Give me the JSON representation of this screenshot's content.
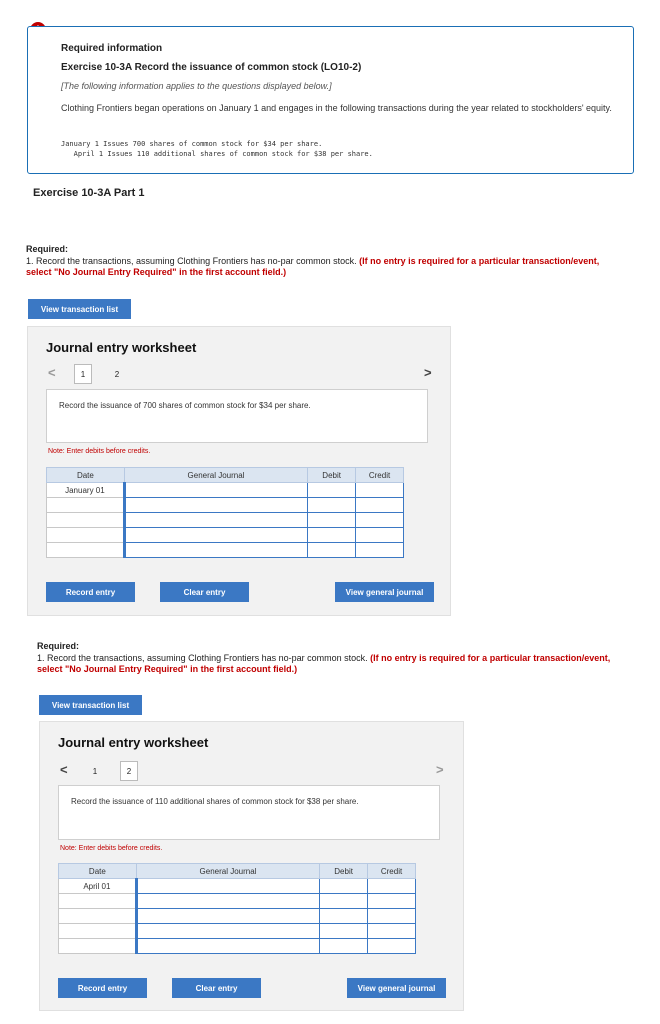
{
  "info": {
    "alert_glyph": "!",
    "title": "Required information",
    "exercise": "Exercise 10-3A Record the issuance of common stock (LO10-2)",
    "note": "[The following information applies to the questions displayed below.]",
    "description": "Clothing Frontiers began operations on January 1 and engages in the following transactions during the year related to stockholders' equity.",
    "transactions": "January 1 Issues 700 shares of common stock for $34 per share.\n   April 1 Issues 110 additional shares of common stock for $38 per share."
  },
  "part_title": "Exercise 10-3A Part 1",
  "required": {
    "label": "Required:",
    "text": "1. Record the transactions, assuming Clothing Frontiers has no-par common stock.",
    "emphasis": "(If no entry is required for a particular transaction/event, select \"No Journal Entry Required\" in the first account field.)"
  },
  "buttons": {
    "view_transactions": "View transaction list",
    "record": "Record entry",
    "clear": "Clear entry",
    "view_journal": "View general journal"
  },
  "worksheet": {
    "title": "Journal entry worksheet",
    "prev": "<",
    "next": ">",
    "page1": "1",
    "page2": "2",
    "note": "Note: Enter debits before credits.",
    "headers": {
      "date": "Date",
      "journal": "General Journal",
      "debit": "Debit",
      "credit": "Credit"
    }
  },
  "ws1": {
    "prompt": "Record the issuance of 700 shares of common stock for $34 per share.",
    "date": "January 01"
  },
  "ws2": {
    "prompt": "Record the issuance of 110 additional shares of common stock for $38 per share.",
    "date": "April 01"
  }
}
